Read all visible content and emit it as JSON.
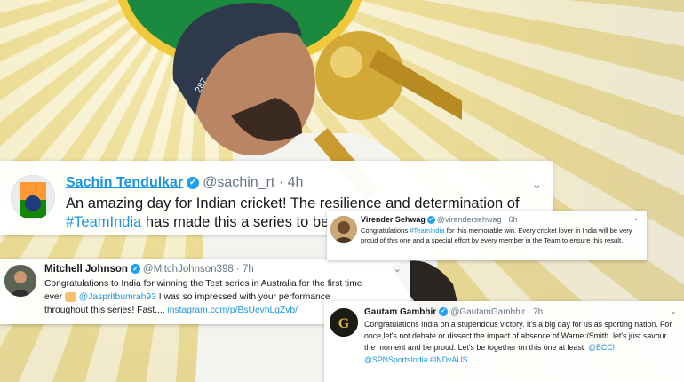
{
  "tweets": {
    "sachin": {
      "name": "Sachin Tendulkar",
      "handle": "@sachin_rt",
      "time": "· 4h",
      "line1": "An amazing day for Indian cricket! The resilience and determination of",
      "hashtag": "#TeamIndia",
      "line2": " has made this a series to be cher"
    },
    "sehwag": {
      "name": "Virender Sehwag",
      "handle": "@virendersehwag",
      "time": "· 6h",
      "text_pre": "Congratulations ",
      "hashtag": "#TeamIndia",
      "text_post": " for this memorable win. Every cricket lover in  India will be very proud of this one and a special effort by every member in the Team to ensure this result."
    },
    "johnson": {
      "name": "Mitchell Johnson",
      "handle": "@MitchJohnson398",
      "time": "· 7h",
      "line1": "Congratulations to India for winning the Test series in Australia for the first time",
      "ever": "ever ",
      "mention": "@Jaspritbumrah93",
      "line2": " I was so impressed with your performance",
      "line3": "throughout this series! Fast.... ",
      "link": "instagram.com/p/BsUevhLgZvb/"
    },
    "gambhir": {
      "name": "Gautam Gambhir",
      "handle": "@GautamGambhir",
      "time": "· 7h",
      "text": "Congratulations India on a stupendous victory. It's a big day for us as sporting nation. For once,let's not debate or dissect the impact of absence of Warner/Smith. let's just savour the moment and be proud. Let's be together on this one at least! ",
      "tags": "@BCCI @SPNSportsIndia #INDvAUS"
    }
  },
  "icons": {
    "verified": "✓",
    "chevron": "⌄"
  }
}
